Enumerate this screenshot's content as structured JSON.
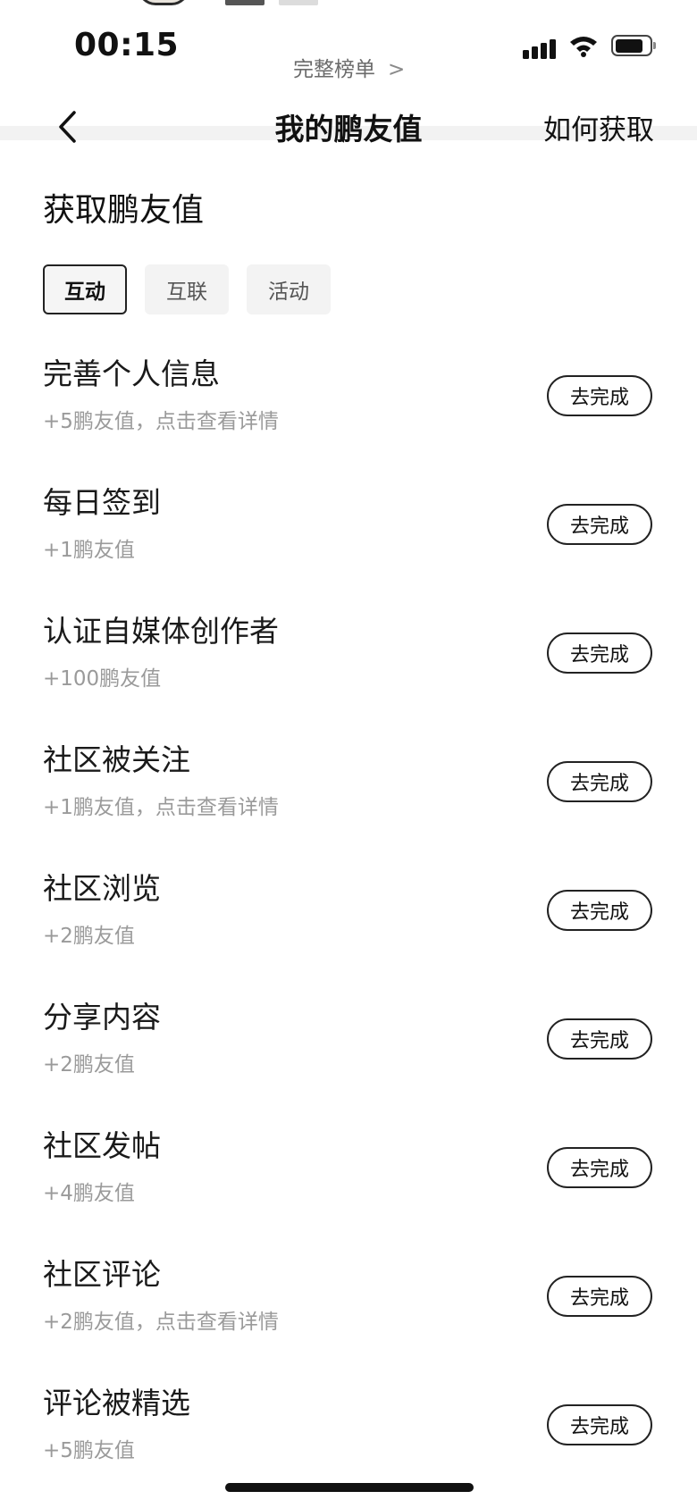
{
  "status_bar": {
    "time": "00:15",
    "icons": [
      "cellular-signal-icon",
      "wifi-icon",
      "battery-icon"
    ]
  },
  "peek": {
    "link_label": "完整榜单",
    "link_icon": "chevron-right-icon"
  },
  "nav": {
    "back_icon": "chevron-left-icon",
    "title": "我的鹏友值",
    "action_label": "如何获取"
  },
  "section": {
    "title": "获取鹏友值"
  },
  "tabs": [
    {
      "label": "互动",
      "active": true
    },
    {
      "label": "互联",
      "active": false
    },
    {
      "label": "活动",
      "active": false
    }
  ],
  "tasks": [
    {
      "title": "完善个人信息",
      "desc": "+5鹏友值，点击查看详情",
      "button": "去完成"
    },
    {
      "title": "每日签到",
      "desc": "+1鹏友值",
      "button": "去完成"
    },
    {
      "title": "认证自媒体创作者",
      "desc": "+100鹏友值",
      "button": "去完成"
    },
    {
      "title": "社区被关注",
      "desc": "+1鹏友值，点击查看详情",
      "button": "去完成"
    },
    {
      "title": "社区浏览",
      "desc": "+2鹏友值",
      "button": "去完成"
    },
    {
      "title": "分享内容",
      "desc": "+2鹏友值",
      "button": "去完成"
    },
    {
      "title": "社区发帖",
      "desc": "+4鹏友值",
      "button": "去完成"
    },
    {
      "title": "社区评论",
      "desc": "+2鹏友值，点击查看详情",
      "button": "去完成"
    },
    {
      "title": "评论被精选",
      "desc": "+5鹏友值",
      "button": "去完成"
    }
  ],
  "colors": {
    "text_primary": "#1a1a1a",
    "text_secondary": "#9a9a9a",
    "tab_bg": "#f3f3f3",
    "border_dark": "#222222"
  }
}
